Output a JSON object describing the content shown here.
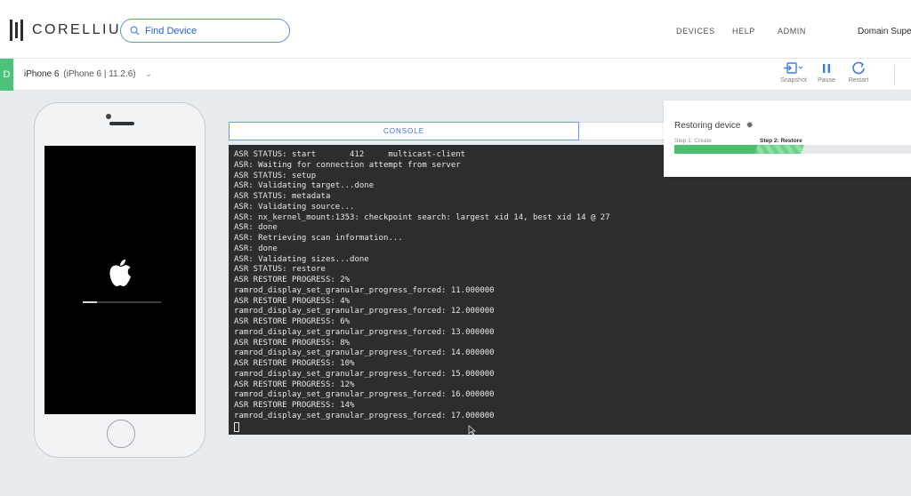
{
  "brand": {
    "name": "CORELLIUM"
  },
  "search": {
    "placeholder": "Find Device"
  },
  "nav": {
    "devices": "DEVICES",
    "help": "HELP",
    "admin": "ADMIN",
    "user": "Domain Supe"
  },
  "device": {
    "badge": "D",
    "name": "iPhone 6",
    "detail": "(iPhone 6 | 11.2.6)",
    "boot_progress": 0.18
  },
  "toolbar": {
    "snapshot": "Snapshot",
    "pause": "Pause",
    "restart": "Restart"
  },
  "console_tab": "CONSOLE",
  "restore": {
    "title": "Restoring device",
    "step1": "Step 1: Create",
    "step2": "Step 2: Restore"
  },
  "console_lines": [
    "ASR STATUS: start       412     multicast-client",
    "ASR: Waiting for connection attempt from server",
    "ASR STATUS: setup",
    "ASR: Validating target...done",
    "ASR STATUS: metadata",
    "ASR: Validating source...",
    "ASR: nx_kernel_mount:1353: checkpoint search: largest xid 14, best xid 14 @ 27",
    "ASR: done",
    "ASR: Retrieving scan information...",
    "ASR: done",
    "ASR: Validating sizes...done",
    "ASR STATUS: restore",
    "ASR RESTORE PROGRESS: 2%",
    "ramrod_display_set_granular_progress_forced: 11.000000",
    "ASR RESTORE PROGRESS: 4%",
    "ramrod_display_set_granular_progress_forced: 12.000000",
    "ASR RESTORE PROGRESS: 6%",
    "ramrod_display_set_granular_progress_forced: 13.000000",
    "ASR RESTORE PROGRESS: 8%",
    "ramrod_display_set_granular_progress_forced: 14.000000",
    "ASR RESTORE PROGRESS: 10%",
    "ramrod_display_set_granular_progress_forced: 15.000000",
    "ASR RESTORE PROGRESS: 12%",
    "ramrod_display_set_granular_progress_forced: 16.000000",
    "ASR RESTORE PROGRESS: 14%",
    "ramrod_display_set_granular_progress_forced: 17.000000"
  ]
}
